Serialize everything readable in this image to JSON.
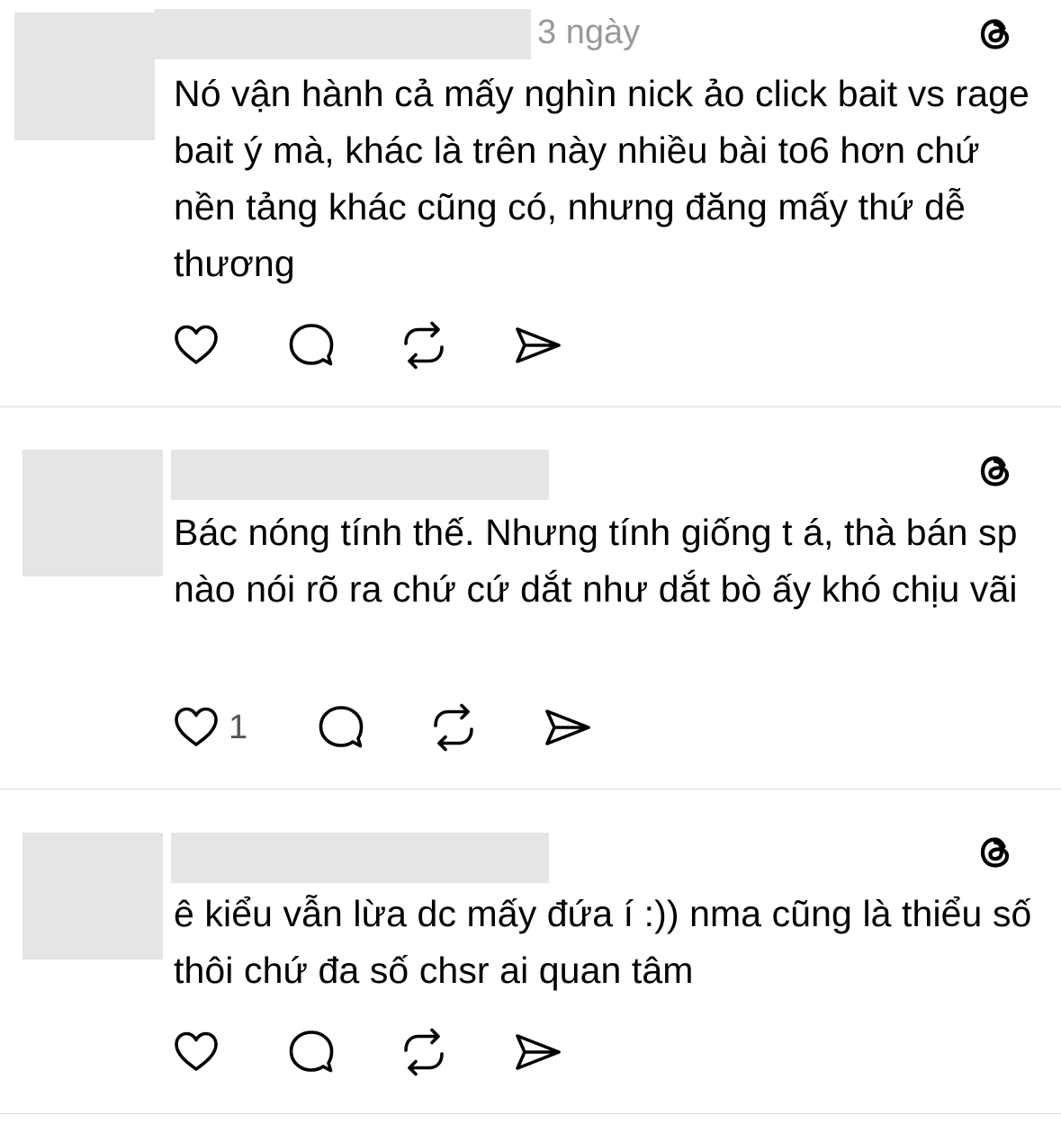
{
  "posts": [
    {
      "timestamp": "3 ngày",
      "text": "Nó vận hành cả mấy nghìn nick ảo click bait vs rage bait ý mà, khác là trên này nhiều bài to6 hơn chứ nền tảng khác cũng có, nhưng đăng mấy thứ dễ thương",
      "likes": ""
    },
    {
      "timestamp": "",
      "text": "Bác nóng tính thế. Nhưng tính giống t á, thà bán sp nào nói rõ ra chứ cứ dắt như dắt bò ấy khó chịu vãi",
      "likes": "1"
    },
    {
      "timestamp": "",
      "text": "ê kiểu vẫn lừa dc mấy đứa í :)) nma cũng là thiểu số thôi chứ đa số chsr ai quan tâm",
      "likes": ""
    }
  ],
  "icons": {
    "brand": "threads-logo-icon",
    "like": "heart-icon",
    "reply": "comment-bubble-icon",
    "repost": "repost-icon",
    "share": "send-icon"
  },
  "colors": {
    "text": "#000000",
    "muted": "#999999",
    "placeholder": "#e5e5e5",
    "divider": "#d9d9d9"
  }
}
